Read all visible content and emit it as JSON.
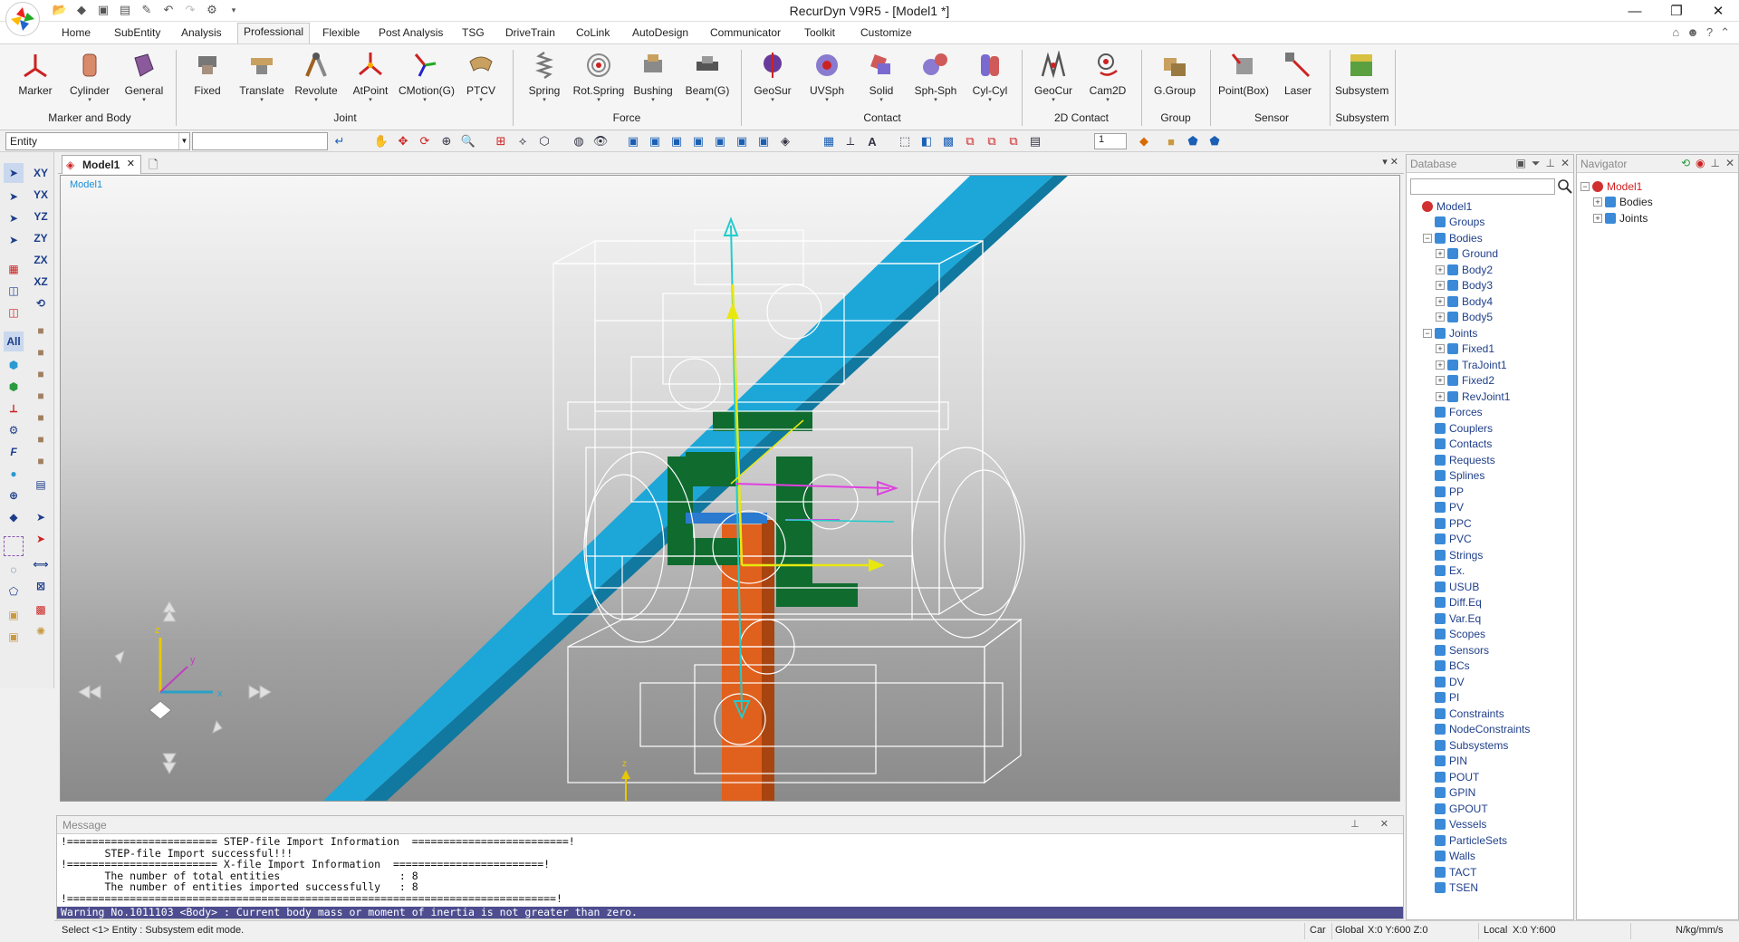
{
  "window": {
    "title": "RecurDyn V9R5  - [Model1 *]",
    "controls": [
      "—",
      "❐",
      "✕"
    ]
  },
  "ribbon": {
    "tabs": [
      "Home",
      "SubEntity",
      "Analysis",
      "Professional",
      "Flexible",
      "Post Analysis",
      "TSG",
      "DriveTrain",
      "CoLink",
      "AutoDesign",
      "Communicator",
      "Toolkit",
      "Customize"
    ],
    "active_tab": "Professional",
    "buttons": [
      {
        "label": "Marker",
        "icon": "marker-icon"
      },
      {
        "label": "Cylinder",
        "icon": "cylinder-icon"
      },
      {
        "label": "General",
        "icon": "general-body-icon"
      },
      {
        "label": "Fixed",
        "icon": "fixed-joint-icon"
      },
      {
        "label": "Translate",
        "icon": "translate-joint-icon"
      },
      {
        "label": "Revolute",
        "icon": "revolute-joint-icon"
      },
      {
        "label": "AtPoint",
        "icon": "atpoint-joint-icon"
      },
      {
        "label": "CMotion(G)",
        "icon": "cmotion-icon"
      },
      {
        "label": "PTCV",
        "icon": "ptcv-icon"
      },
      {
        "label": "Spring",
        "icon": "spring-icon"
      },
      {
        "label": "Rot.Spring",
        "icon": "rot-spring-icon"
      },
      {
        "label": "Bushing",
        "icon": "bushing-icon"
      },
      {
        "label": "Beam(G)",
        "icon": "beam-icon"
      },
      {
        "label": "GeoSur",
        "icon": "geosur-icon"
      },
      {
        "label": "UVSph",
        "icon": "uvsph-icon"
      },
      {
        "label": "Solid",
        "icon": "solid-contact-icon"
      },
      {
        "label": "Sph-Sph",
        "icon": "sph-sph-icon"
      },
      {
        "label": "Cyl-Cyl",
        "icon": "cyl-cyl-icon"
      },
      {
        "label": "GeoCur",
        "icon": "geocur-icon"
      },
      {
        "label": "Cam2D",
        "icon": "cam2d-icon"
      },
      {
        "label": "G.Group",
        "icon": "ggroup-icon"
      },
      {
        "label": "Point(Box)",
        "icon": "point-box-icon"
      },
      {
        "label": "Laser",
        "icon": "laser-icon"
      },
      {
        "label": "Subsystem",
        "icon": "subsystem-icon"
      }
    ],
    "groups": [
      "Marker and Body",
      "Joint",
      "Force",
      "Contact",
      "2D Contact",
      "Group",
      "Sensor",
      "Subsystem"
    ]
  },
  "toolbar": {
    "entity_select": "Entity",
    "number_value": "1"
  },
  "document": {
    "tab_label": "Model1",
    "viewport_label": "Model1"
  },
  "viewport_axes": {
    "x": "x",
    "y": "y",
    "z": "z",
    "bottom_z": "z"
  },
  "message": {
    "header": "Message",
    "lines": [
      "!======================== STEP-file Import Information  =========================!",
      "       STEP-file Import successful!!!",
      "!======================== X-file Import Information  ========================!",
      "       The number of total entities                   : 8",
      "       The number of entities imported successfully   : 8",
      "!==============================================================================!"
    ],
    "warning": "Warning No.1011103 <Body> : Current body mass or moment of inertia is not greater than zero."
  },
  "status": {
    "left": "Select <1> Entity : Subsystem edit mode.",
    "car": "Car",
    "global": "Global",
    "global_coords": "X:0 Y:600 Z:0",
    "local": "Local",
    "local_coords": "X:0 Y:600",
    "units": "N/kg/mm/s"
  },
  "database": {
    "header": "Database",
    "tree": [
      {
        "label": "Model1",
        "level": 0,
        "exp": ""
      },
      {
        "label": "Groups",
        "level": 1,
        "exp": ""
      },
      {
        "label": "Bodies",
        "level": 1,
        "exp": "−"
      },
      {
        "label": "Ground",
        "level": 2,
        "exp": "+"
      },
      {
        "label": "Body2",
        "level": 2,
        "exp": "+"
      },
      {
        "label": "Body3",
        "level": 2,
        "exp": "+"
      },
      {
        "label": "Body4",
        "level": 2,
        "exp": "+"
      },
      {
        "label": "Body5",
        "level": 2,
        "exp": "+"
      },
      {
        "label": "Joints",
        "level": 1,
        "exp": "−"
      },
      {
        "label": "Fixed1",
        "level": 2,
        "exp": "+"
      },
      {
        "label": "TraJoint1",
        "level": 2,
        "exp": "+"
      },
      {
        "label": "Fixed2",
        "level": 2,
        "exp": "+"
      },
      {
        "label": "RevJoint1",
        "level": 2,
        "exp": "+"
      },
      {
        "label": "Forces",
        "level": 1,
        "exp": ""
      },
      {
        "label": "Couplers",
        "level": 1,
        "exp": ""
      },
      {
        "label": "Contacts",
        "level": 1,
        "exp": ""
      },
      {
        "label": "Requests",
        "level": 1,
        "exp": ""
      },
      {
        "label": "Splines",
        "level": 1,
        "exp": ""
      },
      {
        "label": "PP",
        "level": 1,
        "exp": ""
      },
      {
        "label": "PV",
        "level": 1,
        "exp": ""
      },
      {
        "label": "PPC",
        "level": 1,
        "exp": ""
      },
      {
        "label": "PVC",
        "level": 1,
        "exp": ""
      },
      {
        "label": "Strings",
        "level": 1,
        "exp": ""
      },
      {
        "label": "Ex.",
        "level": 1,
        "exp": ""
      },
      {
        "label": "USUB",
        "level": 1,
        "exp": ""
      },
      {
        "label": "Diff.Eq",
        "level": 1,
        "exp": ""
      },
      {
        "label": "Var.Eq",
        "level": 1,
        "exp": ""
      },
      {
        "label": "Scopes",
        "level": 1,
        "exp": ""
      },
      {
        "label": "Sensors",
        "level": 1,
        "exp": ""
      },
      {
        "label": "BCs",
        "level": 1,
        "exp": ""
      },
      {
        "label": "DV",
        "level": 1,
        "exp": ""
      },
      {
        "label": "PI",
        "level": 1,
        "exp": ""
      },
      {
        "label": "Constraints",
        "level": 1,
        "exp": ""
      },
      {
        "label": "NodeConstraints",
        "level": 1,
        "exp": ""
      },
      {
        "label": "Subsystems",
        "level": 1,
        "exp": ""
      },
      {
        "label": "PIN",
        "level": 1,
        "exp": ""
      },
      {
        "label": "POUT",
        "level": 1,
        "exp": ""
      },
      {
        "label": "GPIN",
        "level": 1,
        "exp": ""
      },
      {
        "label": "GPOUT",
        "level": 1,
        "exp": ""
      },
      {
        "label": "Vessels",
        "level": 1,
        "exp": ""
      },
      {
        "label": "ParticleSets",
        "level": 1,
        "exp": ""
      },
      {
        "label": "Walls",
        "level": 1,
        "exp": ""
      },
      {
        "label": "TACT",
        "level": 1,
        "exp": ""
      },
      {
        "label": "TSEN",
        "level": 1,
        "exp": ""
      }
    ]
  },
  "navigator": {
    "header": "Navigator",
    "tree": [
      {
        "label": "Model1",
        "level": 0,
        "exp": "−",
        "color": "#d02020"
      },
      {
        "label": "Bodies",
        "level": 1,
        "exp": "+",
        "color": "#222"
      },
      {
        "label": "Joints",
        "level": 1,
        "exp": "+",
        "color": "#222"
      }
    ]
  },
  "colors": {
    "ribbon_bg": "#f5f5f5",
    "tree_text": "#1f3f8a",
    "warning_bg": "#4d4d8f",
    "beam_blue": "#1ca7d8",
    "column_orange": "#e0601e",
    "part_green": "#0f6b2e"
  }
}
